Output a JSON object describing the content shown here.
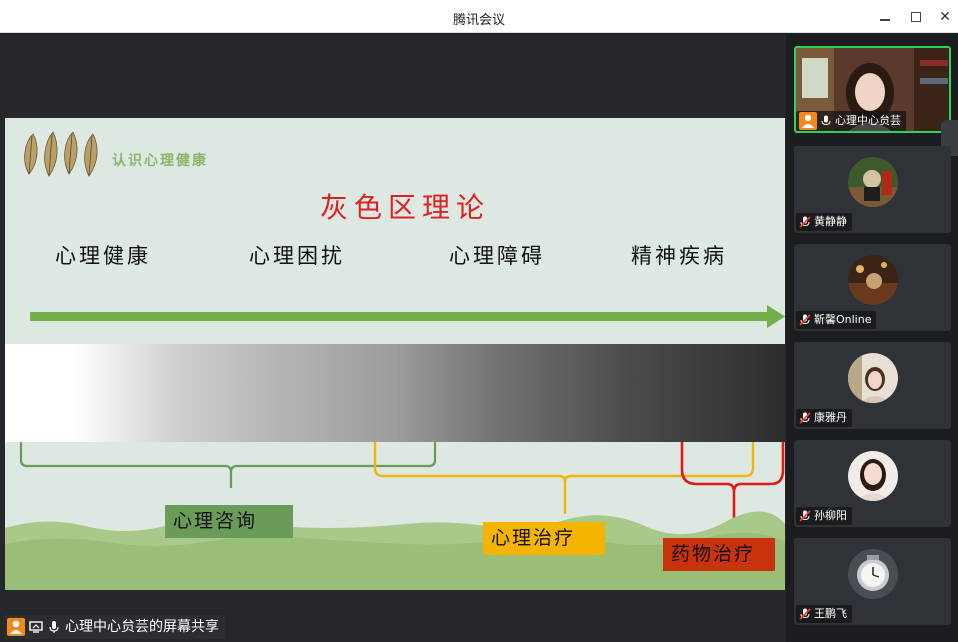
{
  "window": {
    "title": "腾讯会议"
  },
  "slide": {
    "subtitle": "认识心理健康",
    "title": "灰色区理论",
    "stages": [
      "心理健康",
      "心理困扰",
      "心理障碍",
      "精神疾病"
    ],
    "tags": {
      "consult": "心理咨询",
      "therapy": "心理治疗",
      "drug": "药物治疗"
    },
    "colors": {
      "arrow": "#72b04a",
      "title": "#e02020",
      "consult": "#6a9b58",
      "therapy": "#f5b400",
      "drug": "#c8330d"
    }
  },
  "share": {
    "label": "心理中心贠芸的屏幕共享"
  },
  "participants": [
    {
      "name": "心理中心贠芸",
      "host": true,
      "speaking": true
    },
    {
      "name": "黄静静",
      "host": false
    },
    {
      "name": "靳馨Online",
      "host": false
    },
    {
      "name": "康雅丹",
      "host": false
    },
    {
      "name": "孙柳阳",
      "host": false
    },
    {
      "name": "王鹏飞",
      "host": false
    }
  ]
}
